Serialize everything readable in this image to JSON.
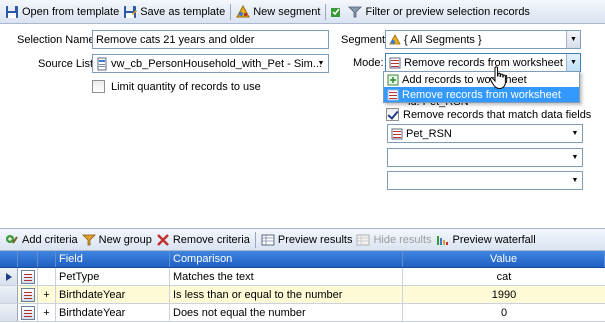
{
  "toolbar": {
    "open_template": "Open from template",
    "save_template": "Save as template",
    "new_segment": "New segment",
    "filter_preview": "Filter or preview selection records"
  },
  "form": {
    "selection_name_label": "Selection Name:",
    "selection_name_value": "Remove cats 21 years and older",
    "source_list_label": "Source List:",
    "source_list_value": "vw_cb_PersonHousehold_with_Pet  -  Sim...",
    "limit_label": "Limit quantity of records to use",
    "segment_label": "Segment:",
    "segment_value": "{ All Segments }",
    "mode_label": "Mode:",
    "mode_value": "Remove records from worksheet",
    "mode_options": [
      "Add records to worksheet",
      "Remove records from worksheet"
    ],
    "hidden_behind": "ld: Pet_RSN",
    "remove_match_label": "Remove records that match data fields",
    "remove_match_checked": true,
    "match_field_1": "Pet_RSN",
    "match_field_2": "",
    "match_field_3": ""
  },
  "criteria_toolbar": {
    "add_criteria": "Add criteria",
    "new_group": "New group",
    "remove_criteria": "Remove criteria",
    "preview_results": "Preview results",
    "hide_results": "Hide results",
    "preview_waterfall": "Preview waterfall"
  },
  "grid": {
    "headers": {
      "field": "Field",
      "comparison": "Comparison",
      "value": "Value"
    },
    "rows": [
      {
        "expander": "",
        "field": "PetType",
        "comparison": "Matches the text",
        "value": "cat"
      },
      {
        "expander": "+",
        "field": "BirthdateYear",
        "comparison": "Is less than or equal to the number",
        "value": "1990"
      },
      {
        "expander": "+",
        "field": "BirthdateYear",
        "comparison": "Does not equal the number",
        "value": "0"
      }
    ]
  },
  "colors": {
    "grid_header": "#2a6fd0",
    "selected_option": "#3399ff",
    "alt_row": "#fffbd6"
  }
}
